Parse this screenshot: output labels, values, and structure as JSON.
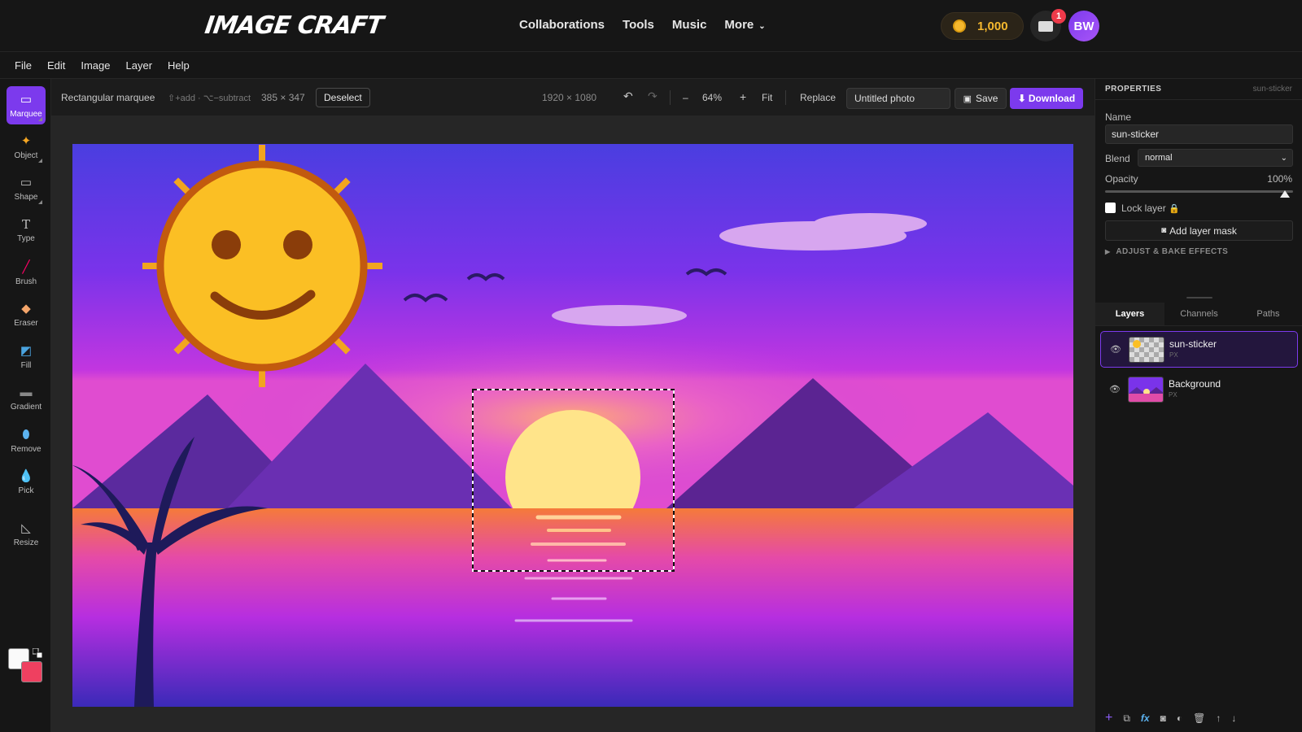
{
  "brand": {
    "logo_text": "IMAGE CRAFT"
  },
  "nav": {
    "links": [
      "Collaborations",
      "Tools",
      "Music",
      "More"
    ],
    "coins": "1,000",
    "notif_count": "1",
    "avatar_initials": "BW"
  },
  "menu": [
    "File",
    "Edit",
    "Image",
    "Layer",
    "Help"
  ],
  "tools": [
    "Marquee",
    "Object",
    "Shape",
    "Type",
    "Brush",
    "Eraser",
    "Fill",
    "Gradient",
    "Remove",
    "Pick",
    "Resize"
  ],
  "options": {
    "tool_name": "Rectangular marquee",
    "hint": "⇧+add · ⌥−subtract",
    "selection_size": "385 × 347",
    "deselect_label": "Deselect",
    "canvas_size": "1920 × 1080",
    "zoom": "64%",
    "zoom_minus": "–",
    "zoom_plus": "+",
    "fit_label": "Fit",
    "replace_label": "Replace",
    "doc_title": "Untitled photo",
    "save_label": "Save",
    "download_label": "Download"
  },
  "colors": {
    "foreground": "#fafafa",
    "background": "#ef4060",
    "accent": "#7c3aed"
  },
  "properties": {
    "header": "PROPERTIES",
    "layer_ref": "sun-sticker",
    "name_label": "Name",
    "name_value": "sun-sticker",
    "blend_label": "Blend",
    "blend_value": "normal",
    "opacity_label": "Opacity",
    "opacity_value": "100%",
    "lock_label": "Lock layer",
    "mask_label": "Add layer mask",
    "adjust_label": "ADJUST & BAKE EFFECTS"
  },
  "panel_tabs": [
    "Layers",
    "Channels",
    "Paths"
  ],
  "layers": [
    {
      "name": "sun-sticker",
      "kind": "PX"
    },
    {
      "name": "Background",
      "kind": "PX"
    }
  ]
}
